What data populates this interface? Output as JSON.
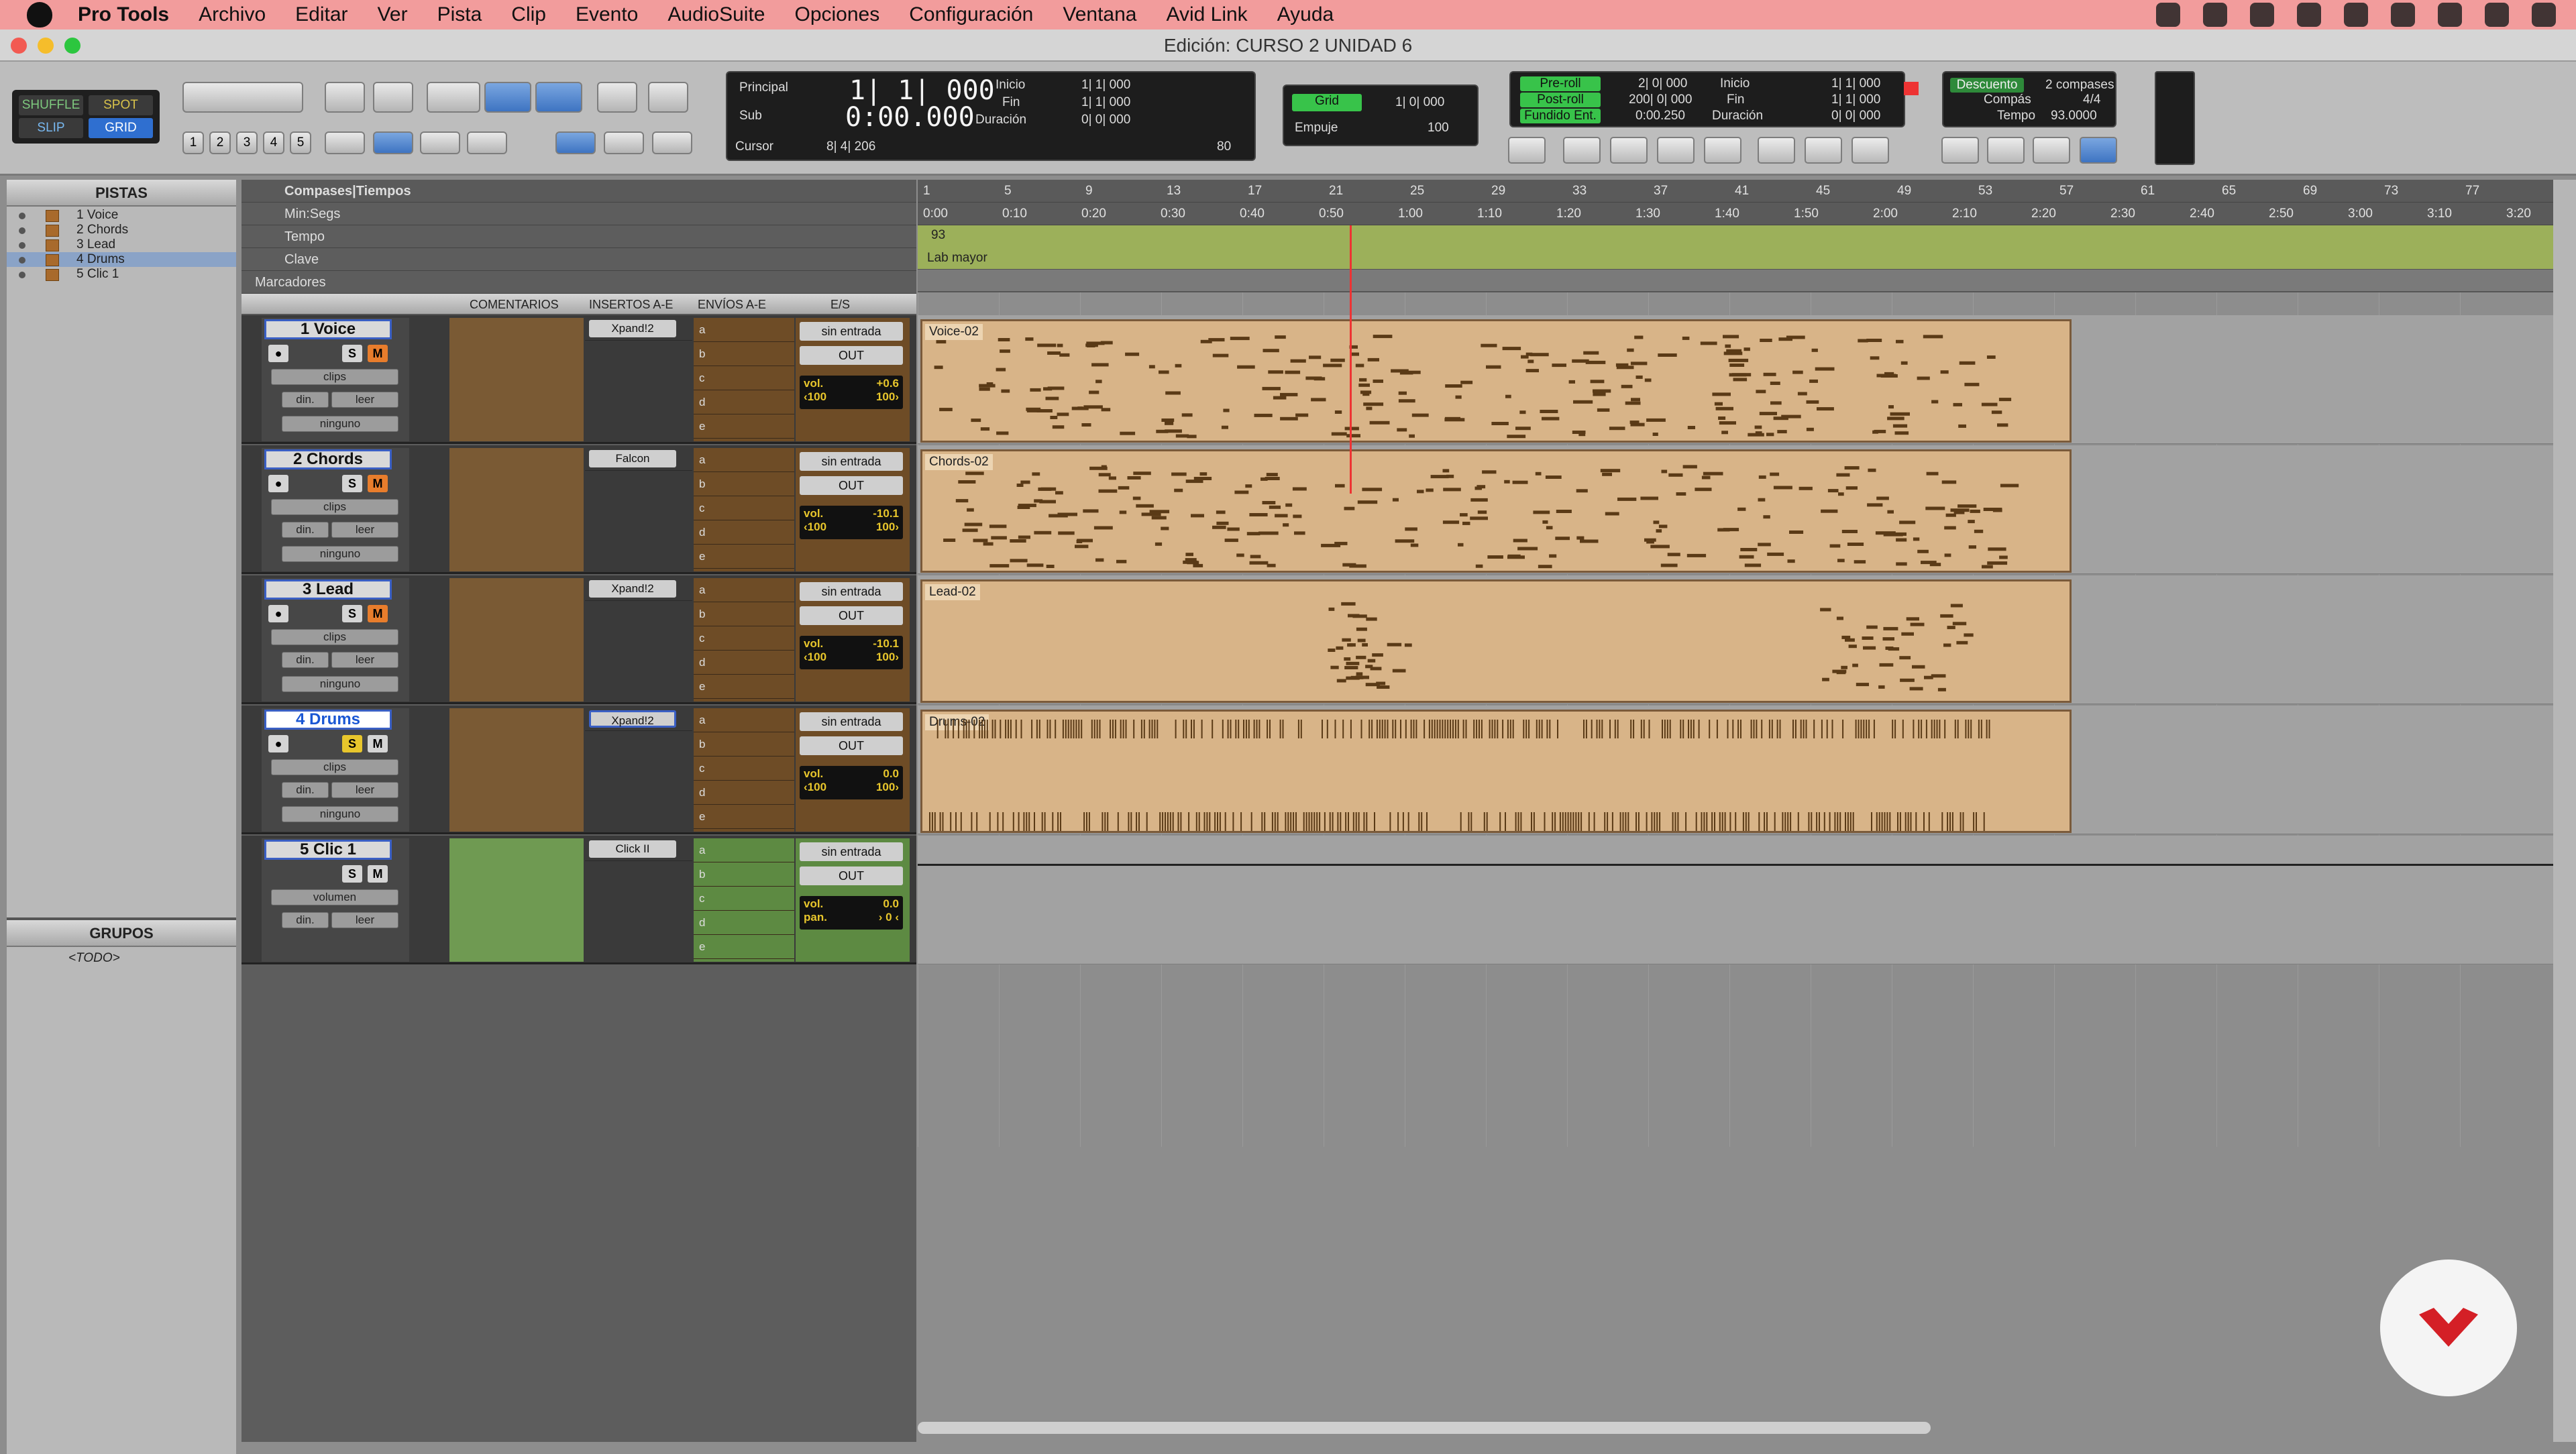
{
  "menubar": {
    "app": "Pro Tools",
    "items": [
      "Archivo",
      "Editar",
      "Ver",
      "Pista",
      "Clip",
      "Evento",
      "AudioSuite",
      "Opciones",
      "Configuración",
      "Ventana",
      "Avid Link",
      "Ayuda"
    ]
  },
  "window": {
    "title": "Edición: CURSO 2 UNIDAD 6"
  },
  "toolbar": {
    "modes": {
      "shuffle": "SHUFFLE",
      "spot": "SPOT",
      "slip": "SLIP",
      "grid": "GRID"
    },
    "zoom_presets": [
      "1",
      "2",
      "3",
      "4",
      "5"
    ],
    "counter": {
      "principal_label": "Principal",
      "sub_label": "Sub",
      "principal": "1| 1| 000",
      "sub": "0:00.000",
      "inicio_label": "Inicio",
      "fin_label": "Fin",
      "duracion_label": "Duración",
      "inicio": "1| 1| 000",
      "fin": "1| 1| 000",
      "duracion": "0| 0| 000",
      "cursor_label": "Cursor",
      "cursor": "8| 4| 206",
      "nudge_val": "80"
    },
    "grid": {
      "label": "Grid",
      "value": "1| 0| 000",
      "empuje_label": "Empuje",
      "empuje": "100"
    },
    "transport": {
      "preroll": "Pre-roll",
      "postroll": "Post-roll",
      "fundido": "Fundido Ent.",
      "preroll_v": "2| 0| 000",
      "postroll_v": "200| 0| 000",
      "fundido_v": "0:00.250",
      "inicio_label": "Inicio",
      "fin_label": "Fin",
      "duracion_label": "Duración",
      "inicio": "1| 1| 000",
      "fin": "1| 1| 000",
      "duracion": "0| 0| 000"
    },
    "count": {
      "descuento": "Descuento",
      "compas_label": "Compás",
      "tempo_label": "Tempo",
      "compases": "2 compases",
      "compas": "4/4",
      "tempo": "93.0000"
    }
  },
  "sidebar": {
    "tracks_header": "PISTAS",
    "tracks": [
      "1 Voice",
      "2 Chords",
      "3 Lead",
      "4 Drums",
      "5 Clic 1"
    ],
    "groups_header": "GRUPOS",
    "groups": [
      "<TODO>"
    ]
  },
  "rulers": {
    "main": "Compases|Tiempos",
    "minsec": "Min:Segs",
    "tempo": "Tempo",
    "clave": "Clave",
    "marcadores": "Marcadores",
    "tempo_value": "93",
    "key_value": "Lab mayor",
    "bars": [
      "1",
      "5",
      "9",
      "13",
      "17",
      "21",
      "25",
      "29",
      "33",
      "37",
      "41",
      "45",
      "49",
      "53",
      "57",
      "61",
      "65",
      "69",
      "73",
      "77"
    ],
    "times": [
      "0:00",
      "0:10",
      "0:20",
      "0:30",
      "0:40",
      "0:50",
      "1:00",
      "1:10",
      "1:20",
      "1:30",
      "1:40",
      "1:50",
      "2:00",
      "2:10",
      "2:20",
      "2:30",
      "2:40",
      "2:50",
      "3:00",
      "3:10",
      "3:20"
    ]
  },
  "columns": {
    "comentarios": "COMENTARIOS",
    "insertos": "INSERTOS A-E",
    "envios": "ENVÍOS A-E",
    "es": "E/S"
  },
  "tracks": [
    {
      "num": "1",
      "name": "Voice",
      "view": "clips",
      "auto": "din.",
      "mode": "leer",
      "group": "ninguno",
      "insert": "Xpand!2",
      "in": "sin entrada",
      "out": "OUT",
      "vol": "vol.",
      "vol_v": "+0.6",
      "pan": "‹100",
      "pan2": "100›",
      "clip": "Voice-02",
      "color": "#7a4f24"
    },
    {
      "num": "2",
      "name": "Chords",
      "view": "clips",
      "auto": "din.",
      "mode": "leer",
      "group": "ninguno",
      "insert": "Falcon",
      "in": "sin entrada",
      "out": "OUT",
      "vol": "vol.",
      "vol_v": "-10.1",
      "pan": "‹100",
      "pan2": "100›",
      "clip": "Chords-02",
      "color": "#7a4f24"
    },
    {
      "num": "3",
      "name": "Lead",
      "view": "clips",
      "auto": "din.",
      "mode": "leer",
      "group": "ninguno",
      "insert": "Xpand!2",
      "in": "sin entrada",
      "out": "OUT",
      "vol": "vol.",
      "vol_v": "-10.1",
      "pan": "‹100",
      "pan2": "100›",
      "clip": "Lead-02",
      "color": "#7a4f24"
    },
    {
      "num": "4",
      "name": "Drums",
      "view": "clips",
      "auto": "din.",
      "mode": "leer",
      "group": "ninguno",
      "insert": "Xpand!2",
      "in": "sin entrada",
      "out": "OUT",
      "vol": "vol.",
      "vol_v": "0.0",
      "pan": "‹100",
      "pan2": "100›",
      "clip": "Drums-02",
      "color": "#7a4f24"
    },
    {
      "num": "5",
      "name": "Clic 1",
      "view": "volumen",
      "auto": "din.",
      "mode": "leer",
      "group": "",
      "insert": "Click II",
      "in": "sin entrada",
      "out": "OUT",
      "vol": "vol.",
      "vol_v": "0.0",
      "pan": "pan.",
      "pan2": "› 0 ‹",
      "clip": "",
      "color": "#6f9a52"
    }
  ],
  "send_slots": [
    "a",
    "b",
    "c",
    "d",
    "e"
  ]
}
